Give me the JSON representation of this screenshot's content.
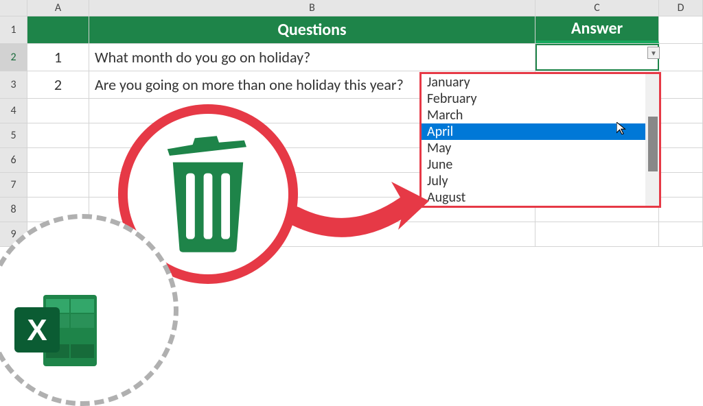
{
  "columns": [
    "A",
    "B",
    "C",
    "D"
  ],
  "rowNumbers": [
    "1",
    "2",
    "3",
    "4",
    "5",
    "6",
    "7",
    "8",
    "9"
  ],
  "headers": {
    "questions": "Questions",
    "answer": "Answer"
  },
  "rows": [
    {
      "num": "1",
      "question": "What month do you go on holiday?"
    },
    {
      "num": "2",
      "question": "Are you going on more than one holiday this year?"
    }
  ],
  "dropdown": {
    "items": [
      "January",
      "February",
      "March",
      "April",
      "May",
      "June",
      "July",
      "August"
    ],
    "highlighted": "April"
  },
  "colors": {
    "excelGreen": "#1e8449",
    "annotationRed": "#e63946",
    "highlightBlue": "#0078d7"
  }
}
